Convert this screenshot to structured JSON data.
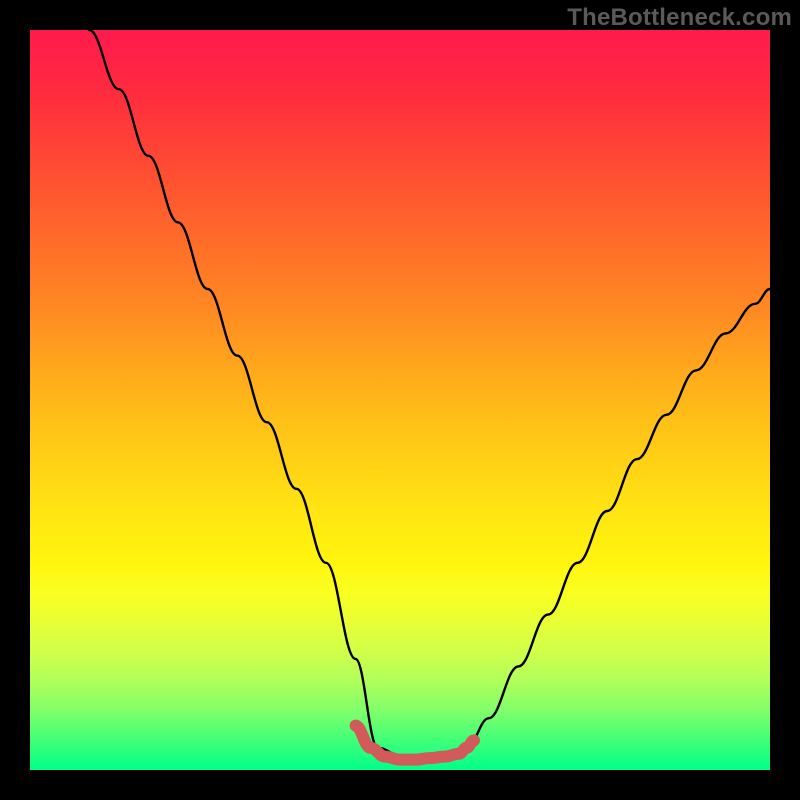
{
  "watermark": {
    "text": "TheBottleneck.com"
  },
  "colors": {
    "frame": "#000000",
    "watermark": "#5a5a5a",
    "curve": "#000000",
    "trough_marker": "#d25a5a",
    "gradient_top": "#ff1a4d",
    "gradient_bottom": "#00ff88"
  },
  "chart_data": {
    "type": "line",
    "title": "",
    "xlabel": "",
    "ylabel": "",
    "xlim": [
      0,
      100
    ],
    "ylim": [
      0,
      100
    ],
    "grid": false,
    "legend": false,
    "notes": "Background is a vertical red→orange→yellow→green gradient (red at top ≈ high value, green at bottom ≈ low). A single black curve starts very high at x≈8, descends steeply to a flat minimum around x≈47–59 at y≈2, then rises with gentle curvature toward the right edge reaching y≈65 at x≈100. A thick salmon segment highlights the flat trough.",
    "series": [
      {
        "name": "curve",
        "color": "#000000",
        "x": [
          8,
          12,
          16,
          20,
          24,
          28,
          32,
          36,
          40,
          44,
          47,
          50,
          53,
          56,
          59,
          62,
          66,
          70,
          74,
          78,
          82,
          86,
          90,
          94,
          98,
          100
        ],
        "values": [
          100,
          92,
          83,
          74,
          65,
          56,
          47,
          38,
          28,
          15,
          3,
          2,
          1.5,
          2,
          3,
          7,
          14,
          21,
          28,
          35,
          42,
          48,
          54,
          59,
          63,
          65
        ]
      }
    ],
    "trough_marker": {
      "name": "trough",
      "color": "#d25a5a",
      "x": [
        44,
        46,
        48,
        50,
        52,
        54,
        56,
        58,
        59,
        60
      ],
      "values": [
        6,
        3,
        1.8,
        1.4,
        1.4,
        1.6,
        1.8,
        2.2,
        3,
        4
      ]
    }
  }
}
